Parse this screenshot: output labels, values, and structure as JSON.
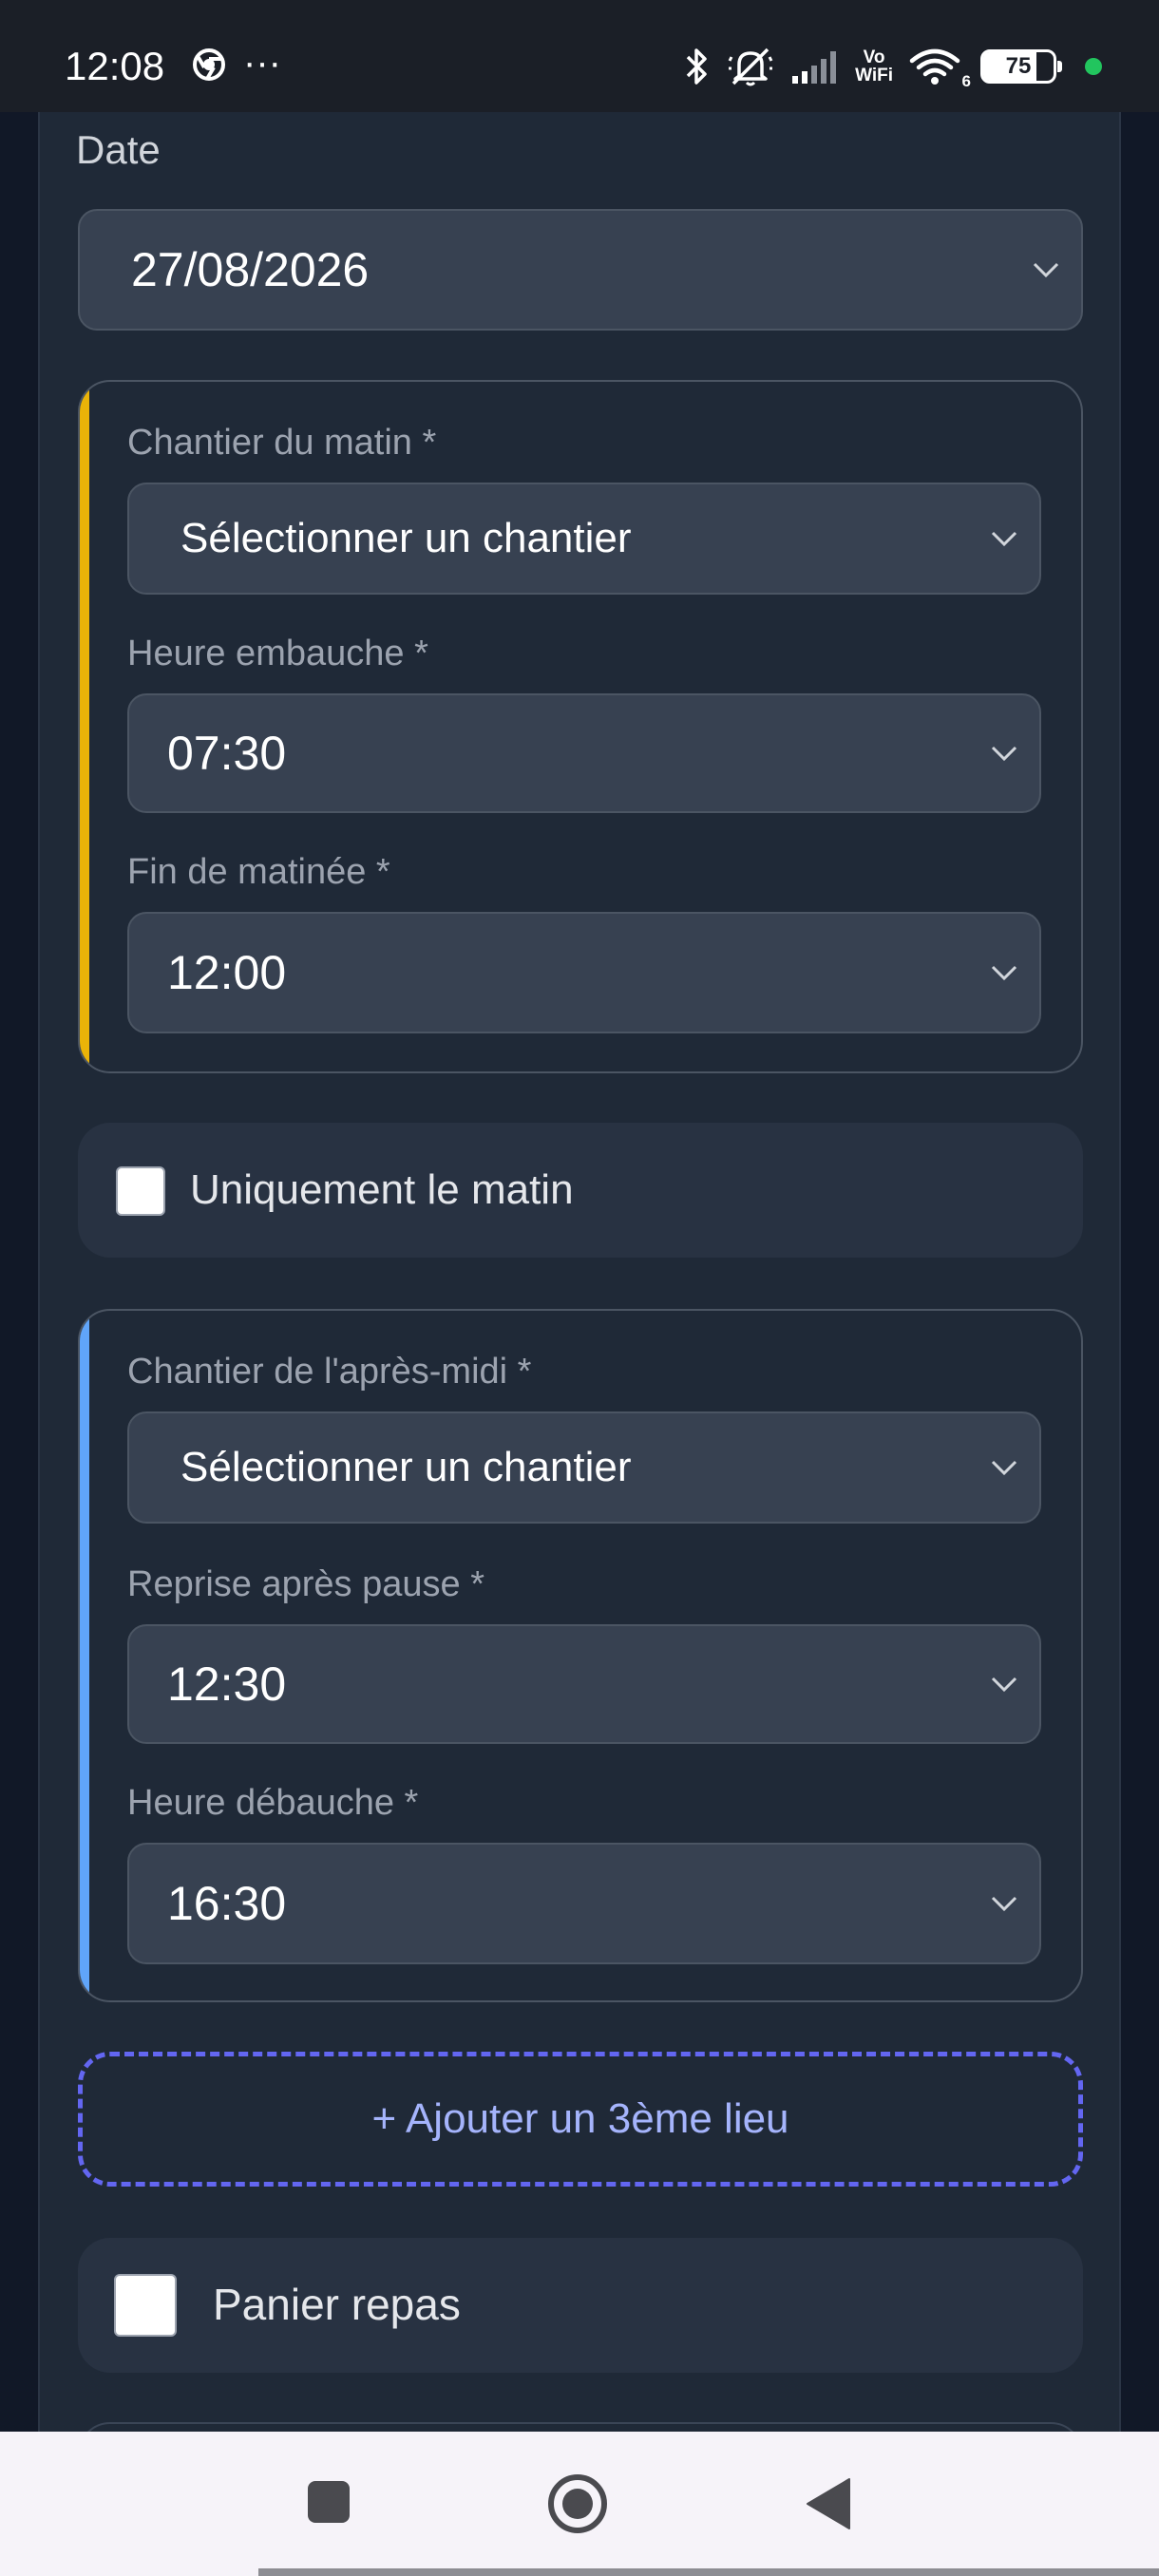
{
  "status_bar": {
    "time": "12:08",
    "overflow": "···",
    "vowifi_top": "Vo",
    "vowifi_bottom": "WiFi",
    "wifi_badge": "6",
    "battery": "75"
  },
  "form": {
    "date_label": "Date",
    "date_value": "27/08/2026",
    "morning": {
      "accent_color": "#eab308",
      "site_label": "Chantier du matin *",
      "site_value": "Sélectionner un chantier",
      "start_label": "Heure embauche *",
      "start_value": "07:30",
      "end_label": "Fin de matinée *",
      "end_value": "12:00"
    },
    "only_morning_label": "Uniquement le matin",
    "afternoon": {
      "accent_color": "#60a5fa",
      "site_label": "Chantier de l'après-midi *",
      "site_value": "Sélectionner un chantier",
      "resume_label": "Reprise après pause *",
      "resume_value": "12:30",
      "end_label": "Heure débauche *",
      "end_value": "16:30"
    },
    "add_location_label": "+ Ajouter un 3ème lieu",
    "meal_basket_label": "Panier repas"
  },
  "nav_bar": {
    "icons": [
      "recents-square-icon",
      "home-circle-icon",
      "back-triangle-icon"
    ]
  }
}
